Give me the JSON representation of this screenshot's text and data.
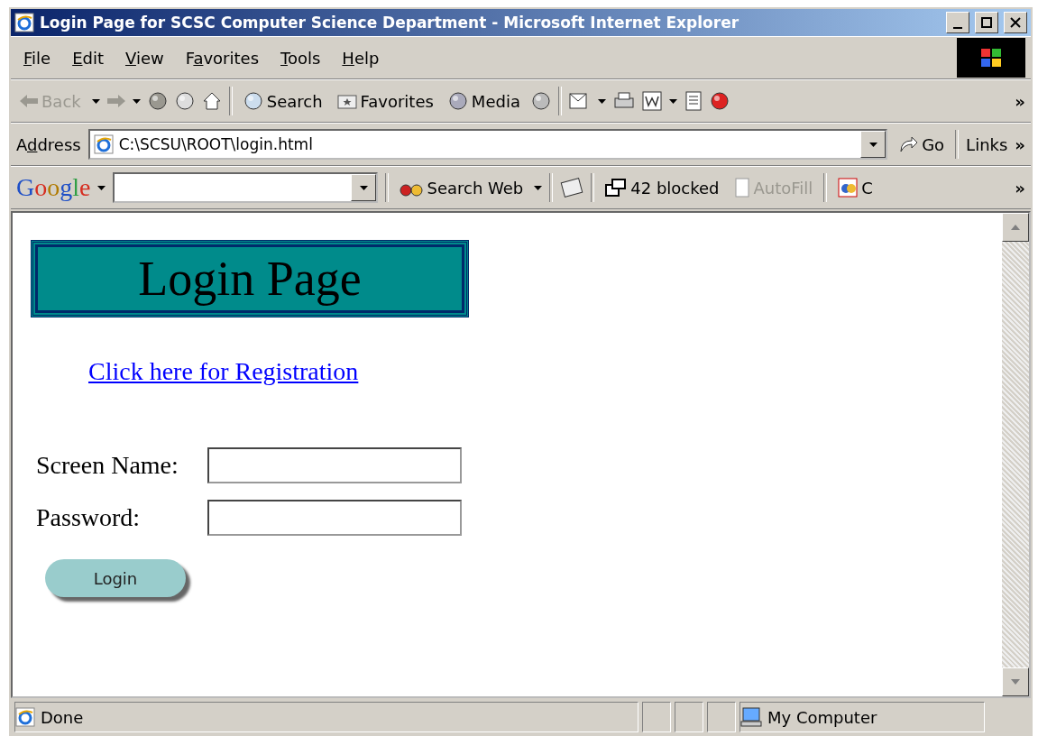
{
  "window": {
    "title": "Login Page for SCSC Computer Science Department - Microsoft Internet Explorer"
  },
  "menu": [
    {
      "label": "File"
    },
    {
      "label": "Edit"
    },
    {
      "label": "View"
    },
    {
      "label": "Favorites"
    },
    {
      "label": "Tools"
    },
    {
      "label": "Help"
    }
  ],
  "toolbar": {
    "back": {
      "label": "Back",
      "disabled": true
    },
    "search": "Search",
    "favorites": "Favorites",
    "media": "Media",
    "more": "»"
  },
  "address_bar": {
    "label": "Address",
    "value": "C:\\SCSU\\ROOT\\login.html",
    "go": "Go",
    "links": "Links",
    "more": "»"
  },
  "google_bar": {
    "logo": "Google",
    "search_web": "Search Web",
    "blocked": "42 blocked",
    "autofill": {
      "label": "AutoFill",
      "disabled": true
    },
    "cut_label": "C",
    "more": "»"
  },
  "page": {
    "heading": "Login Page",
    "registration_link": "Click here for Registration",
    "fields": [
      {
        "label": "Screen Name:"
      },
      {
        "label": "Password:"
      }
    ],
    "login_button": "Login"
  },
  "status_bar": {
    "text": "Done",
    "zone": "My Computer"
  }
}
